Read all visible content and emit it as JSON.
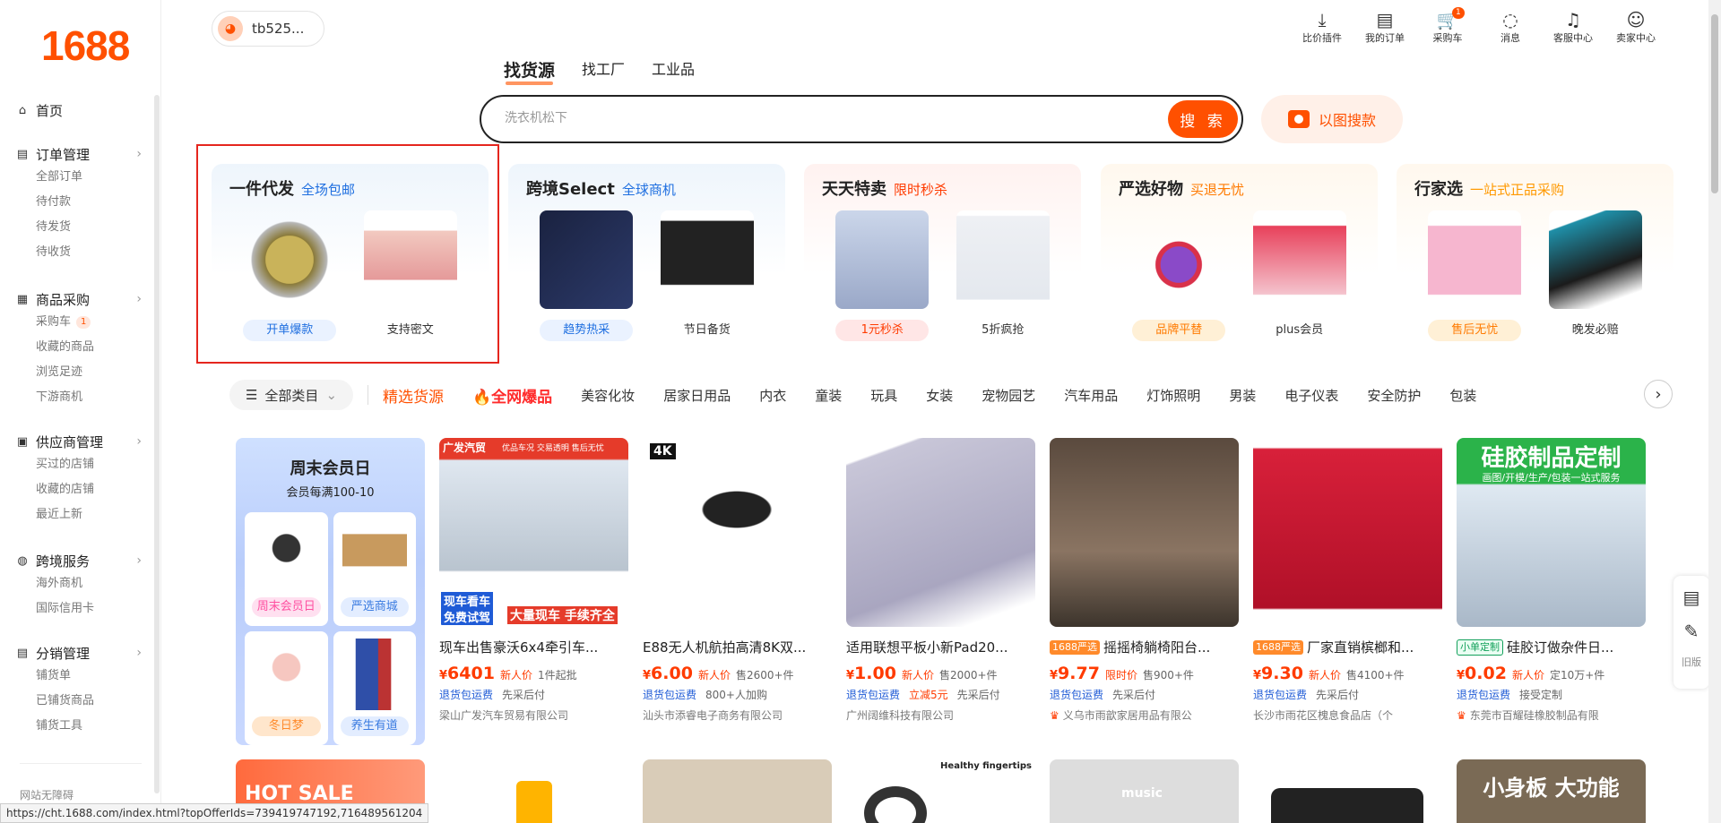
{
  "sidebar": {
    "logo": "1688",
    "home": "首页",
    "groups": [
      {
        "title": "订单管理",
        "icon": "order-icon",
        "items": [
          "全部订单",
          "待付款",
          "待发货",
          "待收货"
        ]
      },
      {
        "title": "商品采购",
        "icon": "grid-icon",
        "items": [
          "采购车",
          "收藏的商品",
          "浏览足迹",
          "下游商机"
        ],
        "cart_badge": "1"
      },
      {
        "title": "供应商管理",
        "icon": "supplier-icon",
        "items": [
          "买过的店铺",
          "收藏的店铺",
          "最近上新"
        ]
      },
      {
        "title": "跨境服务",
        "icon": "globe-icon",
        "items": [
          "海外商机",
          "国际信用卡"
        ]
      },
      {
        "title": "分销管理",
        "icon": "distribution-icon",
        "items": [
          "铺货单",
          "已铺货商品",
          "铺货工具"
        ]
      }
    ],
    "footer": "网站无障碍"
  },
  "status_url": "https://cht.1688.com/index.html?topOfferIds=739419747192,716489561204",
  "header": {
    "username": "tb525...",
    "icons": [
      {
        "label": "比价插件",
        "icon": "download-icon"
      },
      {
        "label": "我的订单",
        "icon": "clipboard-icon"
      },
      {
        "label": "采购车",
        "icon": "cart-icon",
        "badge": "1"
      },
      {
        "label": "消息",
        "icon": "message-icon"
      },
      {
        "label": "客服中心",
        "icon": "headset-icon"
      },
      {
        "label": "卖家中心",
        "icon": "user-icon"
      }
    ]
  },
  "search": {
    "tabs": [
      "找货源",
      "找工厂",
      "工业品"
    ],
    "placeholder": "洗衣机松下",
    "button": "搜 索",
    "image_search": "以图搜款"
  },
  "cards": [
    {
      "title": "一件代发",
      "tag": "全场包邮",
      "tag_color": "#1f6fe0",
      "labels": [
        "开单爆款",
        "支持密文"
      ],
      "bg": "#eef5fc"
    },
    {
      "title": "跨境Select",
      "tag": "全球商机",
      "tag_color": "#1f6fe0",
      "labels": [
        "趋势热采",
        "节日备货"
      ],
      "bg": "#eef5fc"
    },
    {
      "title": "天天特卖",
      "tag": "限时秒杀",
      "tag_color": "#ff3b00",
      "labels": [
        "1元秒杀",
        "5折疯抢"
      ],
      "bg": "#fff2f0"
    },
    {
      "title": "严选好物",
      "tag": "买退无忧",
      "tag_color": "#ff7a00",
      "labels": [
        "品牌平替",
        "plus会员"
      ],
      "bg": "#fff8ee"
    },
    {
      "title": "行家选",
      "tag": "一站式正品采购",
      "tag_color": "#ff9900",
      "labels": [
        "售后无忧",
        "晚发必赔"
      ],
      "bg": "#fff8ee"
    }
  ],
  "categories": {
    "all": "全部类目",
    "featured": "精选货源",
    "hot": "全网爆品",
    "items": [
      "美容化妆",
      "居家日用品",
      "内衣",
      "童装",
      "玩具",
      "女装",
      "宠物园艺",
      "汽车用品",
      "灯饰照明",
      "男装",
      "电子仪表",
      "安全防护",
      "包装"
    ]
  },
  "promo": {
    "title": "周末会员日",
    "subtitle": "会员每满100-10",
    "cells": [
      "周末会员日",
      "严选商城",
      "冬日梦",
      "养生有道"
    ]
  },
  "products": [
    {
      "tag": "",
      "title": "现车出售豪沃6x4牵引车...",
      "price_sym": "¥",
      "price": "6401",
      "price_note": "新人价",
      "sales": "1件起批",
      "svc1": "退货包运费",
      "svc2": "先采后付",
      "svc2_red": false,
      "shop": "梁山广发汽车贸易有限公司",
      "shop_icon": false
    },
    {
      "tag": "",
      "title": "E88无人机航拍高清8K双...",
      "price_sym": "¥",
      "price": "6.00",
      "price_note": "新人价",
      "sales": "售2600+件",
      "svc1": "退货包运费",
      "svc2": "800+人加购",
      "svc2_red": false,
      "shop": "汕头市添睿电子商务有限公司",
      "shop_icon": false
    },
    {
      "tag": "",
      "title": "适用联想平板小新Pad20...",
      "price_sym": "¥",
      "price": "1.00",
      "price_note": "新人价",
      "sales": "售2000+件",
      "svc1": "退货包运费",
      "svc2": "立减5元",
      "svc3": "先采后付",
      "svc2_red": true,
      "shop": "广州阔维科技有限公司",
      "shop_icon": false
    },
    {
      "tag": "1688严选",
      "title": "摇摇椅躺椅阳台...",
      "price_sym": "¥",
      "price": "9.77",
      "price_note": "限时价",
      "sales": "售900+件",
      "svc1": "退货包运费",
      "svc2": "先采后付",
      "svc2_red": false,
      "shop": "义乌市雨歆家居用品有限公",
      "shop_icon": true
    },
    {
      "tag": "1688严选",
      "title": "厂家直销槟榔和...",
      "price_sym": "¥",
      "price": "9.30",
      "price_note": "新人价",
      "sales": "售4100+件",
      "svc1": "退货包运费",
      "svc2": "先采后付",
      "svc2_red": false,
      "shop": "长沙市雨花区槐息食品店（个",
      "shop_icon": false
    },
    {
      "tag": "小单定制",
      "title": "硅胶订做杂件日...",
      "price_sym": "¥",
      "price": "0.02",
      "price_note": "新人价",
      "sales": "定10万+件",
      "svc1": "退货包运费",
      "svc2": "接受定制",
      "svc2_red": false,
      "shop": "东莞市百耀硅橡胶制品有限",
      "shop_icon": true
    }
  ],
  "product_image_text": {
    "p0_top": "广发汽贸",
    "p0_top2": "优品车况 交易透明 售后无忧",
    "p0_bottom1": "现车看车",
    "p0_bottom2": "免费试驾",
    "p0_bottom3": "大量现车 手续齐全",
    "p1_badge": "4K",
    "p5_title": "硅胶制品定制",
    "p5_sub": "画图/开模/生产/包装一站式服务",
    "row2_hot": "HOT SALE",
    "row2_p3": "Healthy fingertips",
    "row2_p4": "music",
    "row2_p6": "小身板 大功能"
  },
  "right_tools": {
    "old_label": "旧版"
  },
  "colors": {
    "accent": "#ff5000",
    "highlight_border": "#e5261e"
  }
}
